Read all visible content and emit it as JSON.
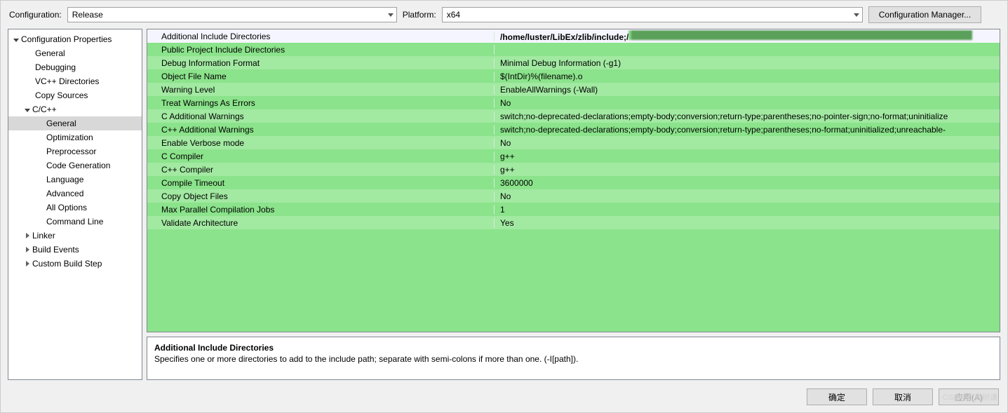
{
  "topbar": {
    "configuration_label": "Configuration:",
    "configuration_value": "Release",
    "platform_label": "Platform:",
    "platform_value": "x64",
    "config_manager_btn": "Configuration Manager..."
  },
  "tree": {
    "root": "Configuration Properties",
    "items": [
      "General",
      "Debugging",
      "VC++ Directories",
      "Copy Sources"
    ],
    "cpp": "C/C++",
    "cpp_items": [
      "General",
      "Optimization",
      "Preprocessor",
      "Code Generation",
      "Language",
      "Advanced",
      "All Options",
      "Command Line"
    ],
    "linker": "Linker",
    "build_events": "Build Events",
    "custom_build": "Custom Build Step"
  },
  "grid": [
    {
      "k": "Additional Include Directories",
      "v": "/home/luster/LibEx/zlib/include;/",
      "hl": true
    },
    {
      "k": "Public Project Include Directories",
      "v": ""
    },
    {
      "k": "Debug Information Format",
      "v": "Minimal Debug Information (-g1)"
    },
    {
      "k": "Object File Name",
      "v": "$(IntDir)%(filename).o"
    },
    {
      "k": "Warning Level",
      "v": "EnableAllWarnings (-Wall)"
    },
    {
      "k": "Treat Warnings As Errors",
      "v": "No"
    },
    {
      "k": "C Additional Warnings",
      "v": "switch;no-deprecated-declarations;empty-body;conversion;return-type;parentheses;no-pointer-sign;no-format;uninitialize"
    },
    {
      "k": "C++ Additional Warnings",
      "v": "switch;no-deprecated-declarations;empty-body;conversion;return-type;parentheses;no-format;uninitialized;unreachable-"
    },
    {
      "k": "Enable Verbose mode",
      "v": "No"
    },
    {
      "k": "C Compiler",
      "v": "g++"
    },
    {
      "k": "C++ Compiler",
      "v": "g++"
    },
    {
      "k": "Compile Timeout",
      "v": "3600000"
    },
    {
      "k": "Copy Object Files",
      "v": "No"
    },
    {
      "k": "Max Parallel Compilation Jobs",
      "v": "1"
    },
    {
      "k": "Validate Architecture",
      "v": "Yes"
    }
  ],
  "desc": {
    "title": "Additional Include Directories",
    "body": "Specifies one or more directories to add to the include path; separate with semi-colons if more than one. (-I[path])."
  },
  "buttons": {
    "ok": "确定",
    "cancel": "取消",
    "apply": "应用(A)"
  },
  "watermark": "CSDN @奇树谦"
}
